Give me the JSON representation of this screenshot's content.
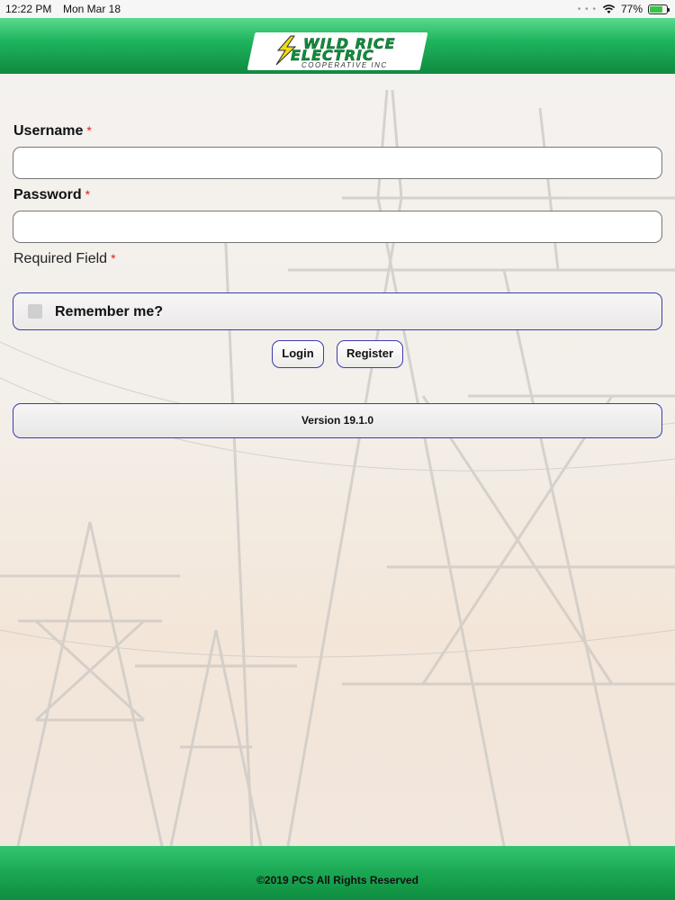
{
  "status_bar": {
    "time": "12:22 PM",
    "date": "Mon Mar 18",
    "signal": "wifi-icon",
    "battery_percent": "77%",
    "battery_level": 0.77
  },
  "header": {
    "logo_line1": "WILD RICE",
    "logo_line2": "ELECTRIC",
    "logo_line3": "COOPERATIVE INC",
    "brand_color": "#1fb55f"
  },
  "form": {
    "username_label": "Username",
    "password_label": "Password",
    "required_marker": "*",
    "username_value": "",
    "password_value": "",
    "required_note": "Required Field",
    "remember_label": "Remember me?",
    "remember_checked": false,
    "login_label": "Login",
    "register_label": "Register",
    "version_label": "Version 19.1.0"
  },
  "footer": {
    "copyright": "©2019 PCS All Rights Reserved"
  },
  "colors": {
    "button_border": "#3d3bb0",
    "required": "#dd2222"
  }
}
